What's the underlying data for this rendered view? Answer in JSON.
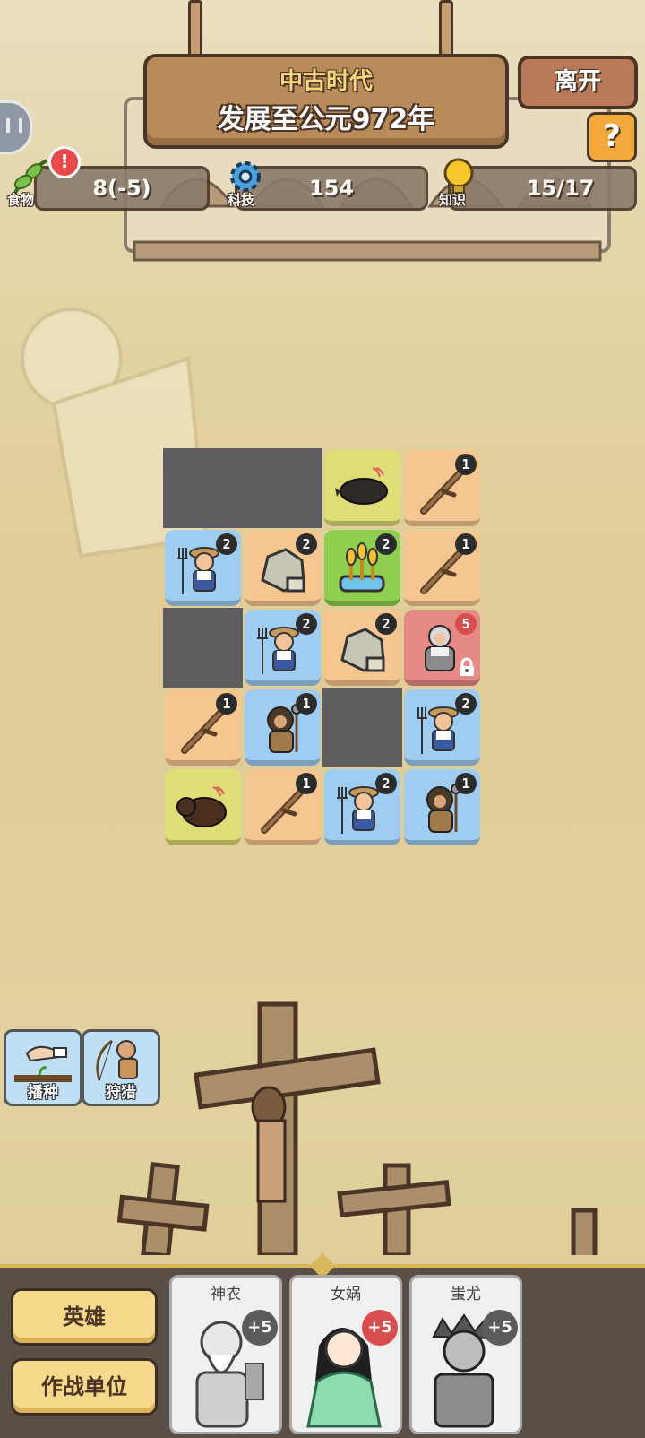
{
  "header": {
    "era": "中古时代",
    "progress_text": "发展至公元972年",
    "leave_label": "离开",
    "help_label": "?"
  },
  "resources": {
    "food": {
      "label": "食物",
      "value": "8(-5)",
      "alert": "!"
    },
    "tech": {
      "label": "科技",
      "value": "154"
    },
    "knowledge": {
      "label": "知识",
      "value": "15/17"
    }
  },
  "board": {
    "rows": [
      [
        {
          "type": "empty"
        },
        {
          "type": "empty"
        },
        {
          "type": "boar",
          "color": "yellow"
        },
        {
          "type": "branch",
          "color": "tan",
          "level": "1"
        }
      ],
      [
        {
          "type": "farmer",
          "color": "blue",
          "level": "2"
        },
        {
          "type": "stone",
          "color": "tan",
          "level": "2"
        },
        {
          "type": "wheat",
          "color": "green",
          "level": "2"
        },
        {
          "type": "branch",
          "color": "tan",
          "level": "1"
        }
      ],
      [
        {
          "type": "empty"
        },
        {
          "type": "farmer",
          "color": "blue",
          "level": "2"
        },
        {
          "type": "stone",
          "color": "tan",
          "level": "2"
        },
        {
          "type": "warrior",
          "color": "red",
          "level": "5",
          "locked": true
        }
      ],
      [
        {
          "type": "branch",
          "color": "tan",
          "level": "1"
        },
        {
          "type": "caveman",
          "color": "blue",
          "level": "1"
        },
        {
          "type": "empty"
        },
        {
          "type": "farmer",
          "color": "blue",
          "level": "2"
        }
      ],
      [
        {
          "type": "bear",
          "color": "yellow"
        },
        {
          "type": "branch",
          "color": "tan",
          "level": "1"
        },
        {
          "type": "farmer",
          "color": "blue",
          "level": "2"
        },
        {
          "type": "caveman",
          "color": "blue",
          "level": "1"
        }
      ]
    ]
  },
  "skills": [
    {
      "label": "播种",
      "icon": "sowing-icon"
    },
    {
      "label": "狩猎",
      "icon": "hunting-icon"
    }
  ],
  "bottom": {
    "heroes_tab": "英雄",
    "units_tab": "作战单位",
    "heroes": [
      {
        "name": "神农",
        "bonus": "+5",
        "highlight": false
      },
      {
        "name": "女娲",
        "bonus": "+5",
        "highlight": true
      },
      {
        "name": "蚩尤",
        "bonus": "+5",
        "highlight": false
      }
    ]
  },
  "colors": {
    "tan": "#f6c690",
    "blue": "#9fcdf1",
    "green": "#8fcf4f",
    "yellow": "#dfdd76",
    "red": "#e58a86",
    "empty": "#5f5c60",
    "wood": "#b98a5a",
    "outline": "#4a3526"
  }
}
